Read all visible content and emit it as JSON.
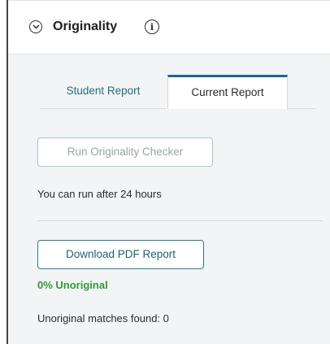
{
  "panel": {
    "title": "Originality",
    "collapse_icon": "chevron-down-circle-icon",
    "info_icon": "info-circle-icon",
    "info_glyph": "i"
  },
  "tabs": [
    {
      "label": "Student Report",
      "selected": false
    },
    {
      "label": "Current Report",
      "selected": true
    }
  ],
  "checker": {
    "run_button_label": "Run Originality Checker",
    "run_button_enabled": false,
    "availability_note": "You can run after 24 hours"
  },
  "report": {
    "download_button_label": "Download PDF Report",
    "unoriginal_score": "0% Unoriginal",
    "matches_text": "Unoriginal matches found: 0"
  },
  "colors": {
    "accent": "#1b6b86",
    "score_green": "#2e9a3a",
    "panel_background": "#f3f4f5"
  }
}
